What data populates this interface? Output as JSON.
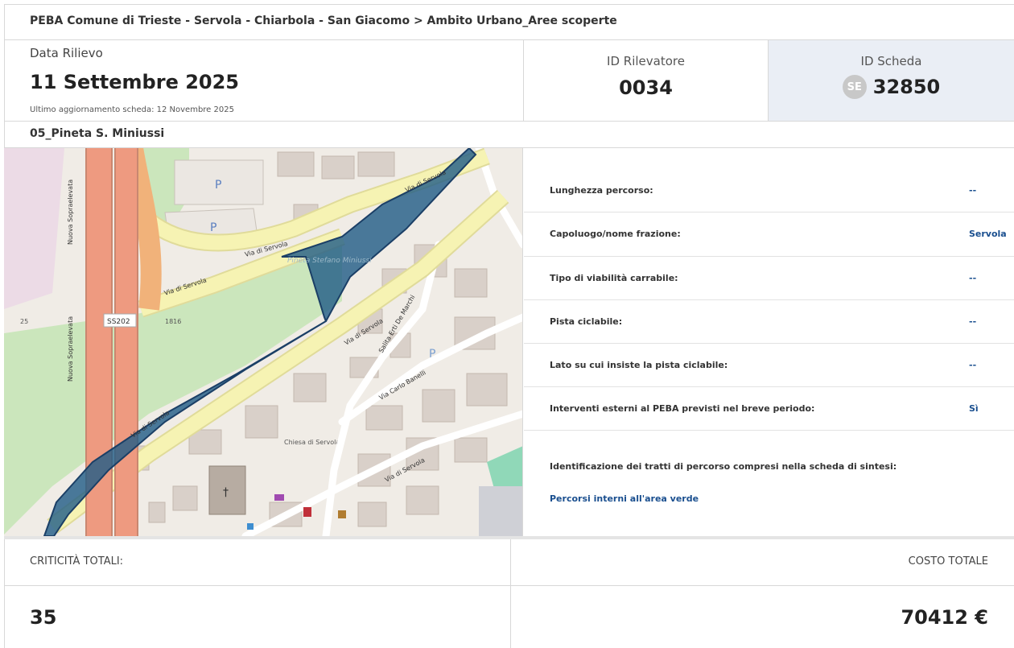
{
  "breadcrumb": "PEBA Comune di Trieste - Servola - Chiarbola - San Giacomo > Ambito Urbano_Aree scoperte",
  "header": {
    "date_label": "Data Rilievo",
    "date_value": "11 Settembre 2025",
    "last_update": "Ultimo aggiornamento scheda: 12 Novembre 2025",
    "rilevatore_label": "ID Rilevatore",
    "rilevatore_value": "0034",
    "scheda_label": "ID Scheda",
    "scheda_badge": "SE",
    "scheda_value": "32850"
  },
  "section_title": "05_Pineta S. Miniussi",
  "map": {
    "labels": {
      "via_servola_1": "Via di Servola",
      "via_servola_2": "Via di Servola",
      "via_servola_3": "Via di Servola",
      "via_servola_4": "Via di Servola",
      "via_servola_5": "Via di Servola",
      "pineta": "Pineta Stefano Miniussi",
      "ss202": "SS202",
      "sopraelevata_1": "Nuova Sopraelevata",
      "sopraelevata_2": "Nuova Sopraelevata",
      "salita": "Salita Erti De Marchi",
      "via_banelli": "Via Carlo Banelli",
      "parking": "P",
      "chiesa": "Chiesa di Servola",
      "n25": "25",
      "n1816": "1816"
    },
    "colors": {
      "polygon_fill": "#1f5b86",
      "polygon_stroke": "#1b3f66",
      "road_yellow": "#f6f3b3",
      "highway": "#ee9a80",
      "park": "#cbe6bc"
    }
  },
  "properties": [
    {
      "label": "Lunghezza percorso:",
      "value": "--"
    },
    {
      "label": "Capoluogo/nome frazione:",
      "value": "Servola"
    },
    {
      "label": "Tipo di viabilità carrabile:",
      "value": "--"
    },
    {
      "label": "Pista ciclabile:",
      "value": "--"
    },
    {
      "label": "Lato su cui insiste la pista ciclabile:",
      "value": "--"
    },
    {
      "label": "Interventi esterni al PEBA previsti nel breve periodo:",
      "value": "Sì"
    }
  ],
  "identification": {
    "label": "Identificazione dei tratti di percorso compresi nella scheda di sintesi:",
    "link": "Percorsi interni all'area verde"
  },
  "footer": {
    "criticita_label": "CRITICITÀ TOTALI:",
    "criticita_value": "35",
    "costo_label": "COSTO TOTALE",
    "costo_value": "70412 €"
  }
}
